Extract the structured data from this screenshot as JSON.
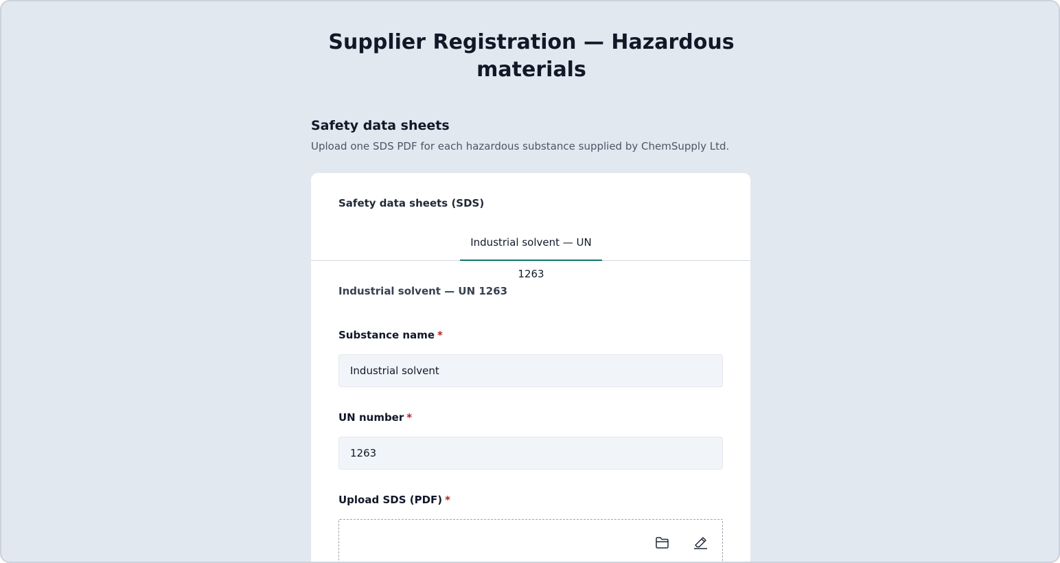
{
  "page": {
    "title": "Supplier Registration — Hazardous materials"
  },
  "section": {
    "heading": "Safety data sheets",
    "description": "Upload one SDS PDF for each hazardous substance supplied by ChemSupply Ltd."
  },
  "card": {
    "label": "Safety data sheets (SDS)",
    "tabs": [
      {
        "label": "Industrial solvent — UN 1263",
        "active": true
      }
    ],
    "panel": {
      "title": "Industrial solvent — UN 1263",
      "fields": {
        "substance_name": {
          "label": "Substance name",
          "required_mark": "*",
          "value": "Industrial solvent"
        },
        "un_number": {
          "label": "UN number",
          "required_mark": "*",
          "value": "1263"
        },
        "upload": {
          "label": "Upload SDS (PDF)",
          "required_mark": "*",
          "icons": [
            "folder-icon",
            "eraser-icon"
          ]
        }
      }
    }
  },
  "colors": {
    "background": "#e2e8f0",
    "accent": "#0f766e",
    "required": "#b91c1c"
  }
}
